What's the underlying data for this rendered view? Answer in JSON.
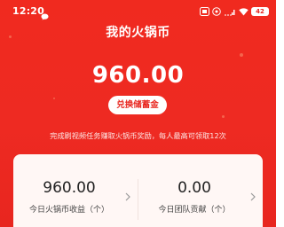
{
  "status_bar": {
    "time": "12:20",
    "battery": "42",
    "icons": [
      "chat-bubble-icon",
      "sim-icon",
      "notification-icon",
      "wifi-icon",
      "battery-icon"
    ]
  },
  "header": {
    "title": "我的火锅币"
  },
  "balance": {
    "value": "960.00"
  },
  "exchange_button": {
    "label": "兑换储蓄金"
  },
  "notice": {
    "text": "完成刷视频任务赚取火锅币奖励，每人最高可领取12次"
  },
  "stats": [
    {
      "value": "960.00",
      "label": "今日火锅币收益（个）"
    },
    {
      "value": "0.00",
      "label": "今日团队贡献（个）"
    }
  ],
  "colors": {
    "background": "#ee2a22",
    "card": "#fff7f5",
    "button_text": "#e8261f"
  }
}
